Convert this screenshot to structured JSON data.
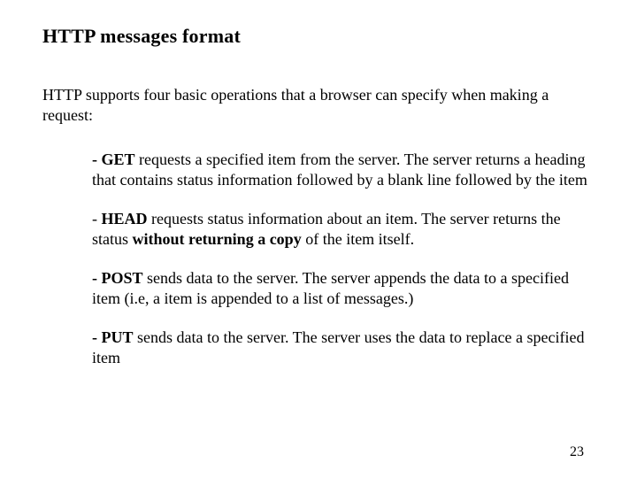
{
  "title": "HTTP messages format",
  "intro": "HTTP supports  four  basic  operations   that a browser can  specify  when making  a  request:",
  "ops": {
    "get": {
      "lead": "- GET",
      "rest": " requests a specified item from the server. The server returns a heading that contains status information followed by a blank line followed by the item"
    },
    "head": {
      "pref": "- ",
      "lead": "HEAD",
      "mid": " requests status information about an item. The server returns   the status ",
      "emph": "without returning a copy",
      "tail": " of the item itself."
    },
    "post": {
      "lead": "- POST",
      "rest": " sends data to the server. The server appends the data to a specified item (i.e, a item is appended to a list of messages.)"
    },
    "put": {
      "lead": "- PUT",
      "rest": " sends data to the server. The server uses the data to replace a specified item"
    }
  },
  "pagenum": "23"
}
